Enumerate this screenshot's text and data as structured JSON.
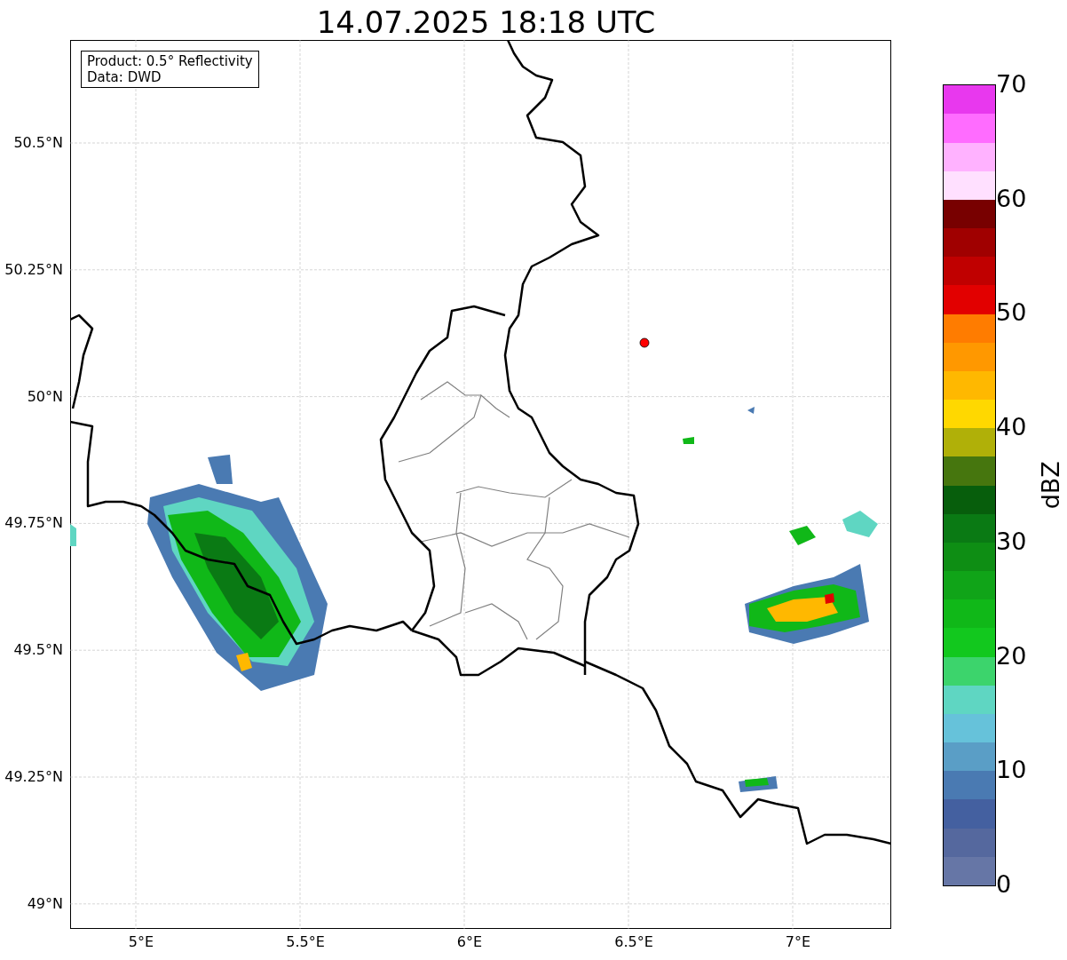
{
  "title": "14.07.2025 18:18 UTC",
  "info_box": {
    "lines": [
      "Product: 0.5° Reflectivity",
      "Data: DWD"
    ]
  },
  "map": {
    "lat_ticks": [
      "50.5°N",
      "50.25°N",
      "50°N",
      "49.75°N",
      "49.5°N",
      "49.25°N",
      "49°N"
    ],
    "lon_ticks": [
      "5°E",
      "5.5°E",
      "6°E",
      "6.5°E",
      "7°E"
    ]
  },
  "colorbar": {
    "label": "dBZ",
    "ticks": [
      "70",
      "60",
      "50",
      "40",
      "30",
      "20",
      "10",
      "0"
    ],
    "bins": [
      {
        "color": "#6676a6"
      },
      {
        "color": "#55689e"
      },
      {
        "color": "#4460a0"
      },
      {
        "color": "#4a7ab2"
      },
      {
        "color": "#5a9ec6"
      },
      {
        "color": "#66c2da"
      },
      {
        "color": "#5fd6c2"
      },
      {
        "color": "#3cd46c"
      },
      {
        "color": "#12c81e"
      },
      {
        "color": "#10b818"
      },
      {
        "color": "#10a418"
      },
      {
        "color": "#0e8e14"
      },
      {
        "color": "#0a7a14"
      },
      {
        "color": "#075e0c"
      },
      {
        "color": "#46760e"
      },
      {
        "color": "#b0b008"
      },
      {
        "color": "#ffd800"
      },
      {
        "color": "#ffb800"
      },
      {
        "color": "#ff9800"
      },
      {
        "color": "#ff7c00"
      },
      {
        "color": "#e20000"
      },
      {
        "color": "#c00000"
      },
      {
        "color": "#a00000"
      },
      {
        "color": "#780000"
      },
      {
        "color": "#ffe0ff"
      },
      {
        "color": "#ffb2ff"
      },
      {
        "color": "#ff6cff"
      },
      {
        "color": "#e838ee"
      }
    ]
  }
}
